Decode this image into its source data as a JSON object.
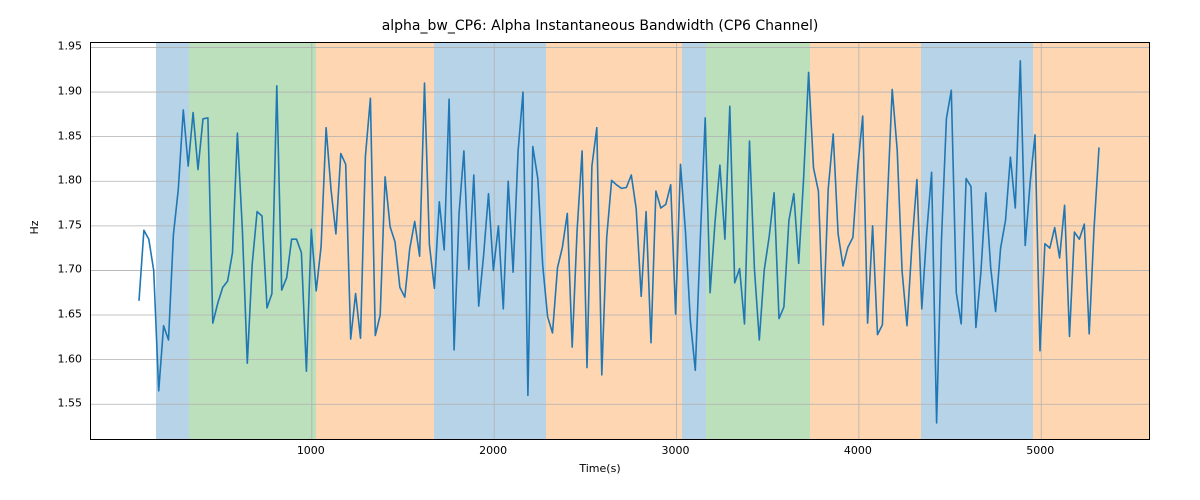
{
  "chart_data": {
    "type": "line",
    "title": "alpha_bw_CP6: Alpha Instantaneous Bandwidth (CP6 Channel)",
    "xlabel": "Time(s)",
    "ylabel": "Hz",
    "xlim": [
      -211,
      5591
    ],
    "ylim": [
      1.511,
      1.955
    ],
    "xticks": [
      1000,
      2000,
      3000,
      4000,
      5000
    ],
    "yticks": [
      1.55,
      1.6,
      1.65,
      1.7,
      1.75,
      1.8,
      1.85,
      1.9,
      1.95
    ],
    "ytick_labels": [
      "1.55",
      "1.60",
      "1.65",
      "1.70",
      "1.75",
      "1.80",
      "1.85",
      "1.90",
      "1.95"
    ],
    "spans": [
      {
        "x0": 143,
        "x1": 329,
        "color": "#1f77b4"
      },
      {
        "x0": 329,
        "x1": 1023,
        "color": "#2ca02c"
      },
      {
        "x0": 1023,
        "x1": 1672,
        "color": "#ff7f0e"
      },
      {
        "x0": 1672,
        "x1": 2282,
        "color": "#1f77b4"
      },
      {
        "x0": 2282,
        "x1": 3030,
        "color": "#ff7f0e"
      },
      {
        "x0": 3030,
        "x1": 3164,
        "color": "#1f77b4"
      },
      {
        "x0": 3164,
        "x1": 3731,
        "color": "#2ca02c"
      },
      {
        "x0": 3731,
        "x1": 4339,
        "color": "#ff7f0e"
      },
      {
        "x0": 4339,
        "x1": 4955,
        "color": "#1f77b4"
      },
      {
        "x0": 4955,
        "x1": 5611,
        "color": "#ff7f0e"
      }
    ],
    "x": [
      52,
      79,
      106,
      133,
      160,
      187,
      214,
      241,
      268,
      295,
      322,
      349,
      376,
      403,
      430,
      457,
      484,
      511,
      538,
      565,
      592,
      619,
      646,
      673,
      700,
      727,
      754,
      781,
      808,
      835,
      862,
      889,
      916,
      943,
      970,
      997,
      1024,
      1051,
      1078,
      1105,
      1132,
      1159,
      1186,
      1213,
      1240,
      1267,
      1294,
      1321,
      1348,
      1375,
      1402,
      1429,
      1456,
      1483,
      1510,
      1537,
      1564,
      1591,
      1618,
      1645,
      1672,
      1699,
      1726,
      1753,
      1780,
      1807,
      1834,
      1861,
      1888,
      1915,
      1942,
      1969,
      1996,
      2023,
      2050,
      2077,
      2104,
      2131,
      2158,
      2185,
      2212,
      2239,
      2266,
      2293,
      2320,
      2347,
      2374,
      2401,
      2428,
      2455,
      2482,
      2509,
      2536,
      2563,
      2590,
      2617,
      2644,
      2671,
      2698,
      2725,
      2752,
      2779,
      2806,
      2833,
      2860,
      2887,
      2914,
      2941,
      2968,
      2995,
      3022,
      3049,
      3076,
      3103,
      3130,
      3157,
      3184,
      3211,
      3238,
      3265,
      3292,
      3319,
      3346,
      3373,
      3400,
      3427,
      3454,
      3481,
      3508,
      3535,
      3562,
      3589,
      3616,
      3643,
      3670,
      3697,
      3724,
      3751,
      3778,
      3805,
      3832,
      3859,
      3886,
      3913,
      3940,
      3967,
      3994,
      4021,
      4048,
      4075,
      4102,
      4129,
      4156,
      4183,
      4210,
      4237,
      4264,
      4291,
      4318,
      4345,
      4372,
      4399,
      4426,
      4453,
      4480,
      4507,
      4534,
      4561,
      4588,
      4615,
      4642,
      4669,
      4696,
      4723,
      4750,
      4777,
      4804,
      4831,
      4858,
      4885,
      4912,
      4939,
      4966,
      4993,
      5020,
      5047,
      5074,
      5101,
      5128,
      5155,
      5182,
      5209,
      5236,
      5263,
      5290,
      5317
    ],
    "y": [
      1.666,
      1.745,
      1.735,
      1.7,
      1.565,
      1.638,
      1.622,
      1.74,
      1.791,
      1.88,
      1.817,
      1.877,
      1.813,
      1.87,
      1.871,
      1.641,
      1.663,
      1.681,
      1.688,
      1.72,
      1.854,
      1.745,
      1.596,
      1.707,
      1.766,
      1.761,
      1.658,
      1.674,
      1.907,
      1.678,
      1.692,
      1.735,
      1.735,
      1.72,
      1.587,
      1.746,
      1.677,
      1.727,
      1.86,
      1.791,
      1.741,
      1.831,
      1.819,
      1.623,
      1.674,
      1.624,
      1.828,
      1.893,
      1.627,
      1.65,
      1.805,
      1.749,
      1.732,
      1.681,
      1.67,
      1.724,
      1.755,
      1.716,
      1.91,
      1.729,
      1.68,
      1.777,
      1.723,
      1.892,
      1.611,
      1.763,
      1.834,
      1.701,
      1.807,
      1.66,
      1.717,
      1.786,
      1.7,
      1.75,
      1.657,
      1.8,
      1.698,
      1.834,
      1.9,
      1.56,
      1.839,
      1.803,
      1.706,
      1.648,
      1.63,
      1.703,
      1.726,
      1.764,
      1.614,
      1.745,
      1.834,
      1.591,
      1.817,
      1.86,
      1.583,
      1.737,
      1.801,
      1.796,
      1.792,
      1.793,
      1.807,
      1.769,
      1.671,
      1.766,
      1.619,
      1.789,
      1.77,
      1.774,
      1.796,
      1.651,
      1.819,
      1.743,
      1.643,
      1.588,
      1.732,
      1.871,
      1.675,
      1.754,
      1.818,
      1.735,
      1.884,
      1.686,
      1.702,
      1.64,
      1.845,
      1.702,
      1.622,
      1.7,
      1.738,
      1.787,
      1.646,
      1.659,
      1.756,
      1.786,
      1.708,
      1.803,
      1.922,
      1.815,
      1.789,
      1.639,
      1.791,
      1.853,
      1.741,
      1.705,
      1.726,
      1.737,
      1.816,
      1.873,
      1.641,
      1.75,
      1.628,
      1.639,
      1.776,
      1.903,
      1.835,
      1.699,
      1.638,
      1.728,
      1.802,
      1.657,
      1.742,
      1.81,
      1.529,
      1.735,
      1.87,
      1.902,
      1.675,
      1.64,
      1.803,
      1.794,
      1.636,
      1.698,
      1.787,
      1.703,
      1.654,
      1.725,
      1.756,
      1.827,
      1.77,
      1.935,
      1.728,
      1.798,
      1.852,
      1.61,
      1.73,
      1.725,
      1.748,
      1.714,
      1.773,
      1.626,
      1.743,
      1.735,
      1.752,
      1.629,
      1.748,
      1.838
    ]
  }
}
